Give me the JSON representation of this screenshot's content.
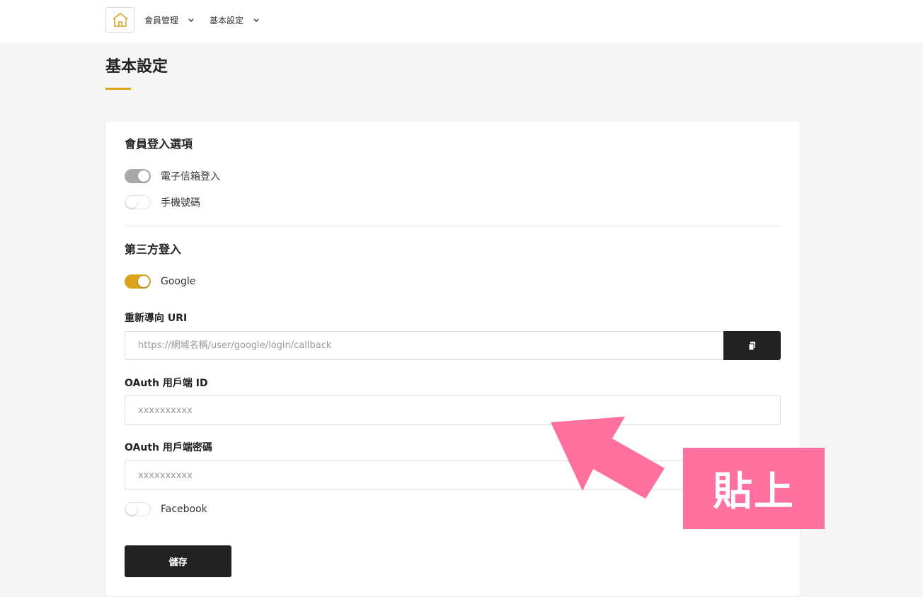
{
  "nav": {
    "logo_icon": "house-icon",
    "items": [
      {
        "label": "會員管理",
        "icon": "chevron-down-icon"
      },
      {
        "label": "基本設定",
        "icon": "chevron-down-icon"
      }
    ]
  },
  "page": {
    "title": "基本設定"
  },
  "member_login": {
    "title": "會員登入選項",
    "options": [
      {
        "label": "電子信箱登入",
        "enabled": true
      },
      {
        "label": "手機號碼",
        "enabled": false
      }
    ]
  },
  "third_party": {
    "title": "第三方登入",
    "google": {
      "label": "Google",
      "enabled": true
    },
    "redirect_label": "重新導向 URI",
    "redirect_placeholder": "https://網域名稱/user/google/login/callback",
    "copy_icon": "copy-icon",
    "client_id_label": "OAuth 用戶端 ID",
    "client_id_placeholder": "xxxxxxxxxx",
    "client_secret_label": "OAuth 用戶端密碼",
    "client_secret_placeholder": "xxxxxxxxxx",
    "facebook": {
      "label": "Facebook",
      "enabled": false
    }
  },
  "save_label": "儲存",
  "annotation": {
    "text": "貼上"
  },
  "colors": {
    "accent": "#d9a31a",
    "toggle_on_grey": "#a9a9a9",
    "dark": "#222222",
    "annotation": "#ff6496"
  }
}
